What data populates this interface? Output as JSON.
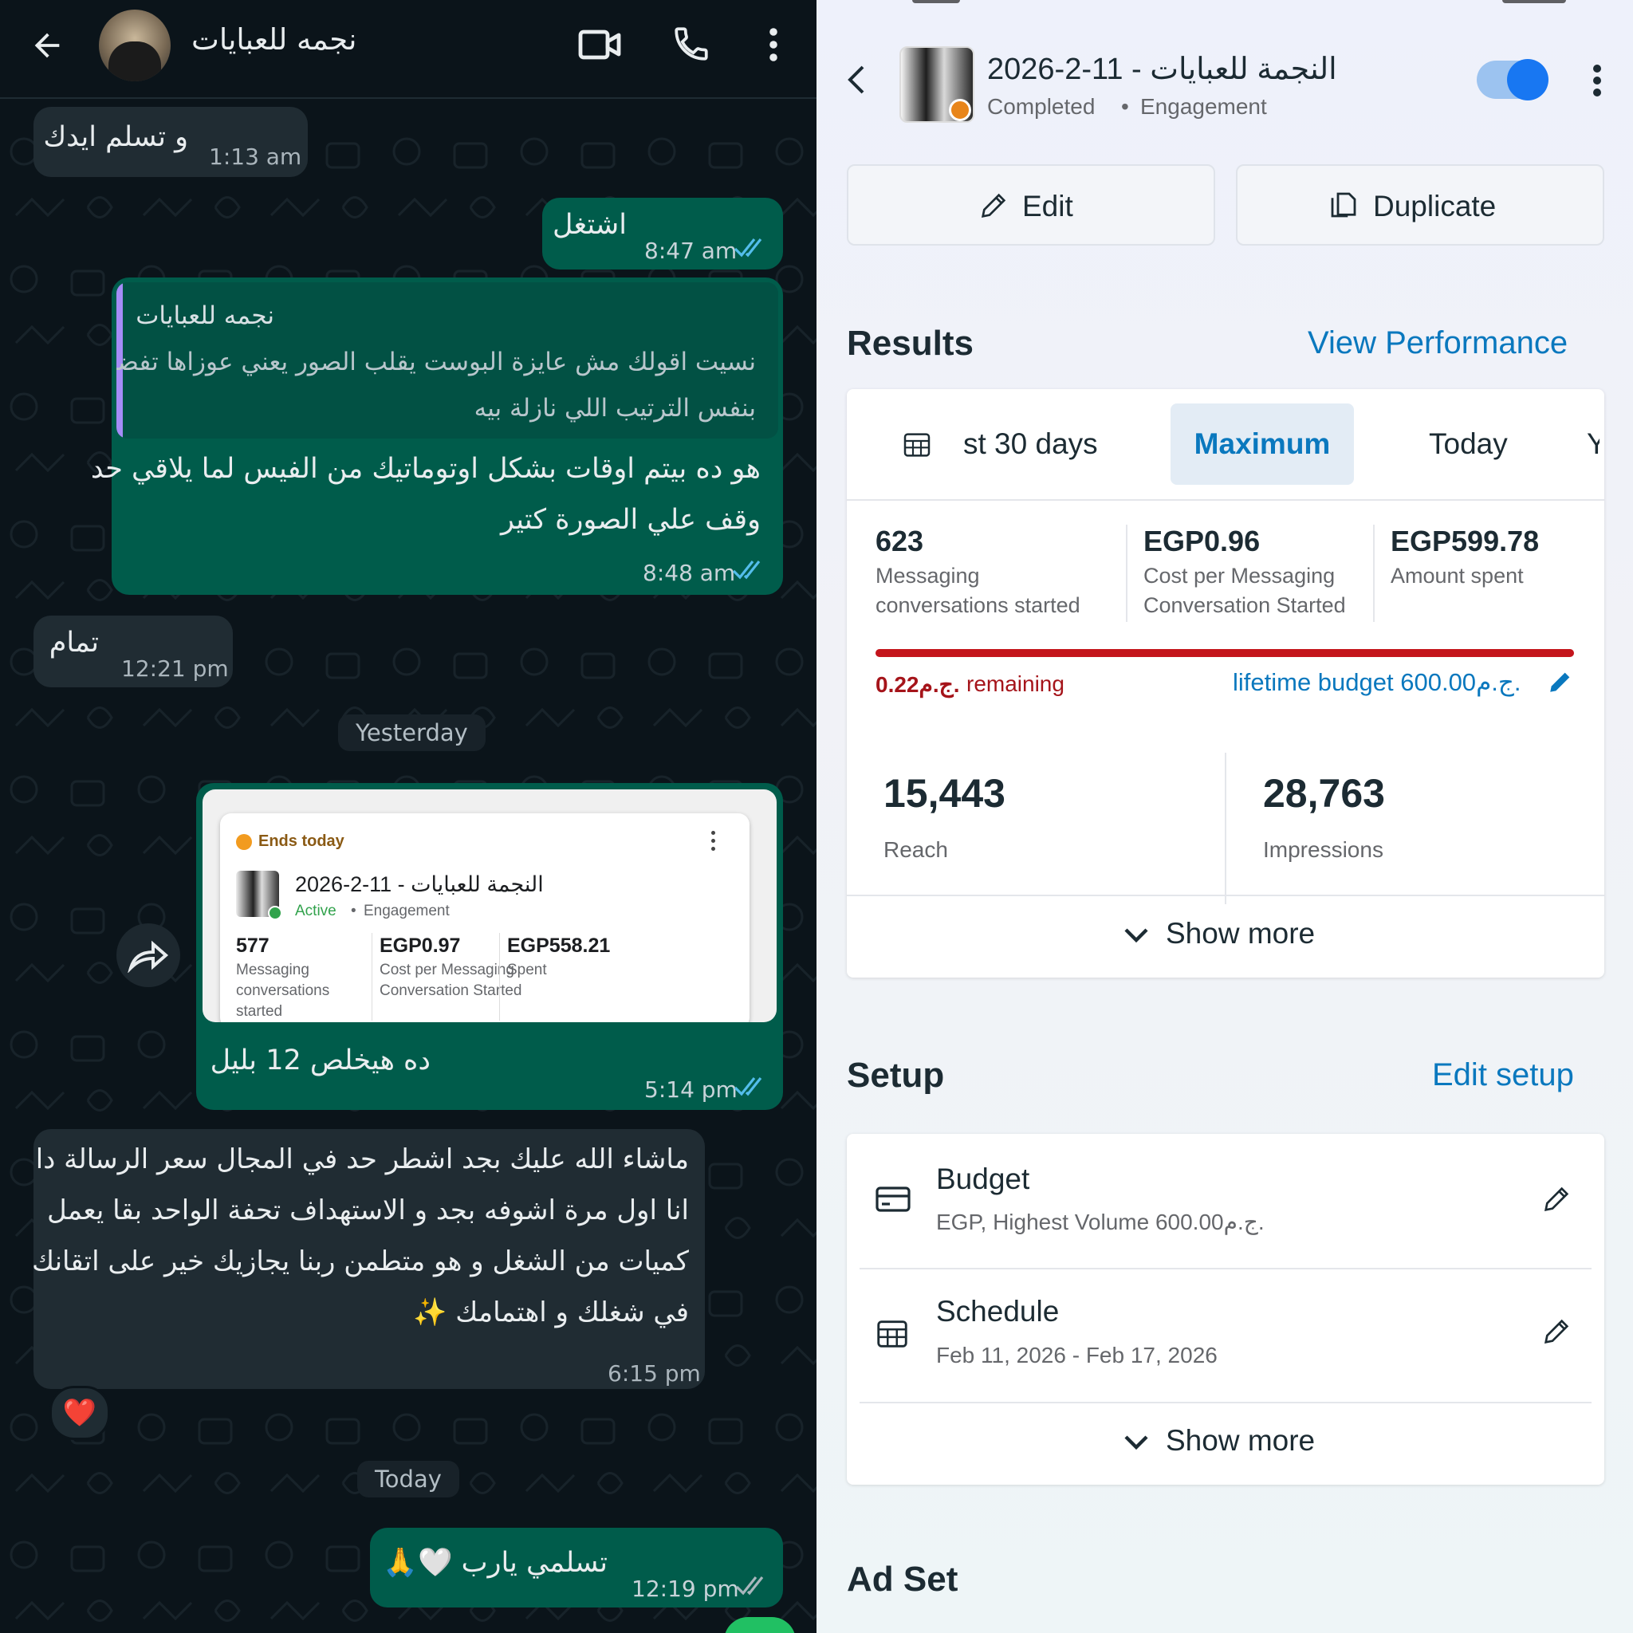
{
  "chat": {
    "header": {
      "contact_name": "نجمه للعبايات"
    },
    "messages": [
      {
        "dir": "in",
        "text": "و تسلم ايدك",
        "time": "1:13 am"
      },
      {
        "dir": "out",
        "text": "اشتغل",
        "time": "8:47 am"
      },
      {
        "dir": "out",
        "quote_author": "نجمه للعبايات",
        "quote_line1": "نسيت اقولك مش عايزة البوست يقلب الصور يعني عوزاها تفضل",
        "quote_line2": "بنفس الترتيب اللي نازلة بيه",
        "line1": "هو ده بيتم اوقات بشكل اوتوماتيك من الفيس لما يلاقي حد",
        "line2": "وقف علي الصورة كتير",
        "time": "8:48 am"
      },
      {
        "dir": "in",
        "text": "تمام",
        "time": "12:21 pm"
      }
    ],
    "day_yesterday": "Yesterday",
    "forwarded": {
      "card": {
        "badge": "Ends today",
        "campaign": "النجمة للعبايات - 11-2-2026",
        "status": "Active",
        "objective": "Engagement",
        "m1_val": "577",
        "m1_line1": "Messaging",
        "m1_line2": "conversations",
        "m1_line3": "started",
        "m2_val": "EGP0.97",
        "m2_line1": "Cost per Messaging",
        "m2_line2": "Conversation Started",
        "m3_val": "EGP558.21",
        "m3_line1": "Spent"
      },
      "caption": "ده هيخلص 12 بليل",
      "time": "5:14 pm"
    },
    "long_msg": {
      "line1": "ماشاء الله عليك بجد اشطر حد في المجال سعر الرسالة دا",
      "line2": "انا اول مرة اشوفه بجد و الاستهداف تحفة الواحد بقا يعمل",
      "line3": "كميات من الشغل و هو متطمن ربنا يجازيك خير على اتقانك",
      "line4": "في شغلك و اهتمامك ✨",
      "time": "6:15 pm",
      "reaction": "❤️"
    },
    "day_today": "Today",
    "last_msg": {
      "text": "تسلمي يارب 🤍🙏",
      "time": "12:19 pm"
    }
  },
  "ads": {
    "campaign_title": "النجمة للعبايات - 11-2-2026",
    "status": "Completed",
    "objective": "Engagement",
    "edit_label": "Edit",
    "duplicate_label": "Duplicate",
    "results_title": "Results",
    "view_performance": "View Performance",
    "tabs": [
      "st 30 days",
      "Maximum",
      "Today",
      "Y"
    ],
    "active_tab": "Maximum",
    "metrics": [
      {
        "value": "623",
        "line1": "Messaging",
        "line2": "conversations started"
      },
      {
        "value": "EGP0.96",
        "line1": "Cost per Messaging",
        "line2": "Conversation Started"
      },
      {
        "value": "EGP599.78",
        "line1": "Amount spent",
        "line2": ""
      }
    ],
    "budget_used_fraction": 0.9996,
    "remaining_amount": "0.22ج.م.",
    "remaining_label": "remaining",
    "lifetime_budget": "lifetime budget 600.00ج.م.",
    "reach_value": "15,443",
    "reach_label": "Reach",
    "impressions_value": "28,763",
    "impressions_label": "Impressions",
    "show_more": "Show more",
    "setup_title": "Setup",
    "edit_setup": "Edit setup",
    "budget_title": "Budget",
    "budget_sub": "EGP, Highest Volume 600.00ج.م.",
    "schedule_title": "Schedule",
    "schedule_sub": "Feb 11, 2026 - Feb 17, 2026",
    "show_more_2": "Show more",
    "adset_title": "Ad Set",
    "colors": {
      "accent": "#0a78be",
      "budget_bar": "#c4151c",
      "toggle": "#1877f2"
    }
  }
}
